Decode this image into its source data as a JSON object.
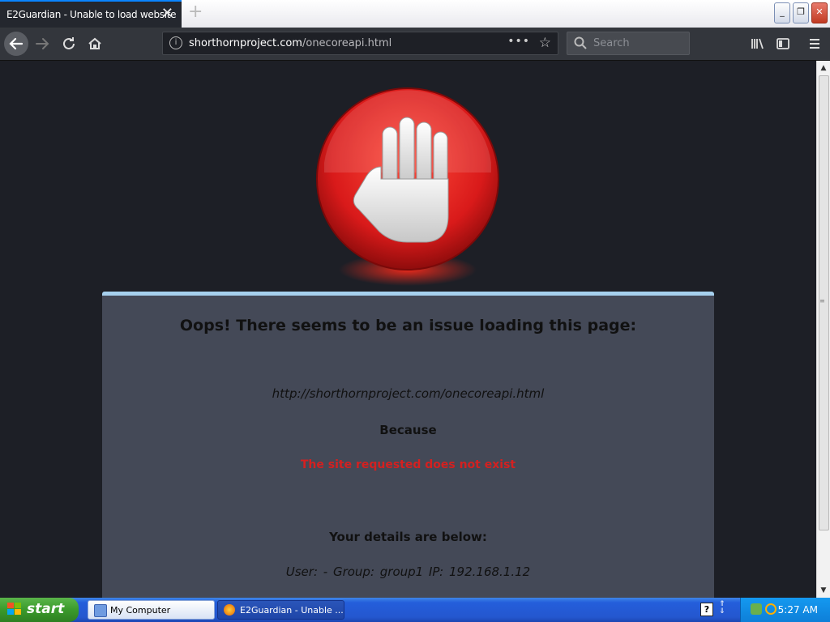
{
  "browser": {
    "tab_title": "E2Guardian - Unable to load website",
    "tab_close": "✕",
    "new_tab": "+",
    "url_host": "shorthornproject.com",
    "url_path": "/onecoreapi.html",
    "search_placeholder": "Search",
    "page_actions": "•••"
  },
  "window_buttons": {
    "minimize": "_",
    "restore": "❐",
    "close": "✕"
  },
  "page": {
    "heading": "Oops! There seems to be an issue loading this page:",
    "url": "http://shorthornproject.com/onecoreapi.html",
    "because": "Because",
    "reason": "The site requested does not exist",
    "details_heading": "Your details are below:",
    "details": "User: -   Group: group1   IP: 192.168.1.12"
  },
  "colors": {
    "stop_sign": "#d91a1a",
    "panel_bg": "#444957",
    "panel_border": "#a6d0ee",
    "reason_text": "#d42020"
  },
  "taskbar": {
    "start_label": "start",
    "buttons": [
      {
        "label": "My Computer",
        "icon": "my-computer-icon"
      },
      {
        "label": "E2Guardian - Unable ...",
        "icon": "firefox-icon"
      }
    ],
    "help": "?",
    "clock": "5:27 AM"
  }
}
